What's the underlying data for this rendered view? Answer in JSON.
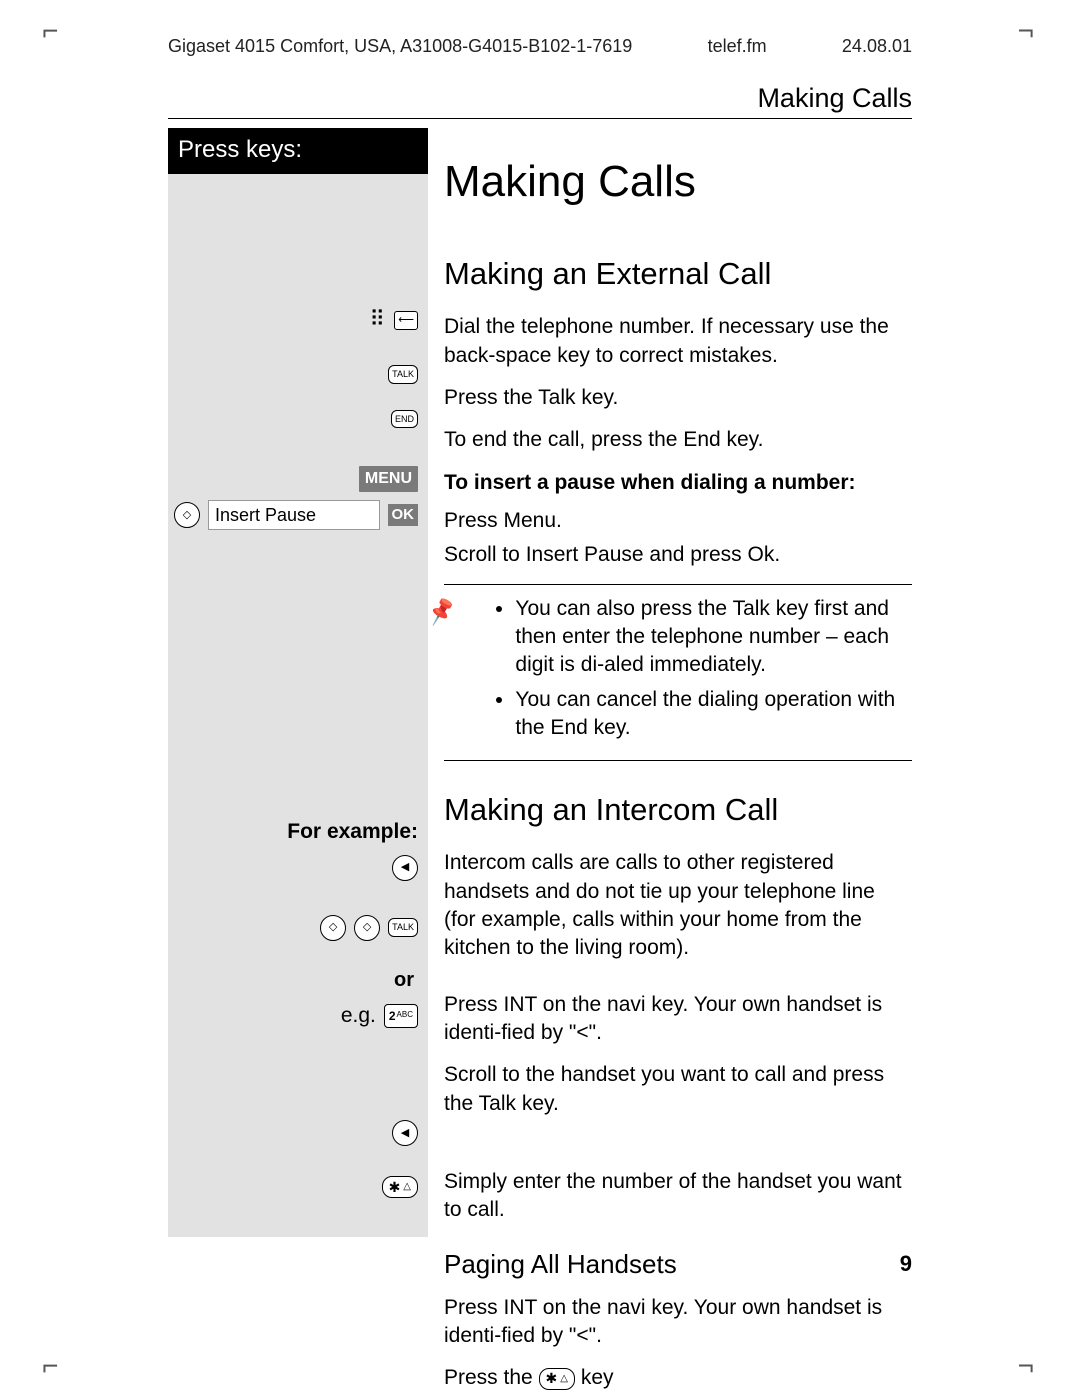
{
  "header": {
    "left": "Gigaset 4015 Comfort, USA, A31008-G4015-B102-1-7619",
    "center": "telef.fm",
    "right": "24.08.01"
  },
  "running_head": "Making Calls",
  "sidebar": {
    "title": "Press keys:",
    "insert_pause": "Insert Pause",
    "menu_key": "MENU",
    "ok_key": "OK",
    "for_example": "For example:",
    "or": "or",
    "eg": "e.g.",
    "key2": "2",
    "key2_sub": "ABC",
    "talk": "TALK",
    "end": "END"
  },
  "main": {
    "h1": "Making Calls",
    "s1": {
      "title": "Making an External Call",
      "p1": "Dial the telephone number. If necessary use the back-space key to correct mistakes.",
      "p2": "Press the Talk key.",
      "p3": "To end the call, press the End key.",
      "sub": "To  insert a pause when dialing a number:",
      "p4": "Press Menu.",
      "p5": "Scroll to Insert Pause and press Ok.",
      "note1": "You can also press the Talk key first and then enter the telephone number  – each digit is di-aled immediately.",
      "note2": "You can cancel the dialing operation with the End key."
    },
    "s2": {
      "title": "Making an Intercom Call",
      "p1": "Intercom calls are calls to other registered handsets and do not tie up your telephone line (for example, calls within your home from the kitchen to the living room).",
      "p2": "Press INT on the navi key. Your own handset is identi-fied by \"<\".",
      "p3": "Scroll to the handset you want to call and press the Talk key.",
      "p4": "Simply enter the number of the handset you want to call."
    },
    "s3": {
      "title": "Paging All Handsets",
      "p1": "Press INT on the navi key.  Your own handset is identi-fied by \"<\".",
      "p2a": "Press the ",
      "p2b": " key"
    }
  },
  "page_number": "9"
}
